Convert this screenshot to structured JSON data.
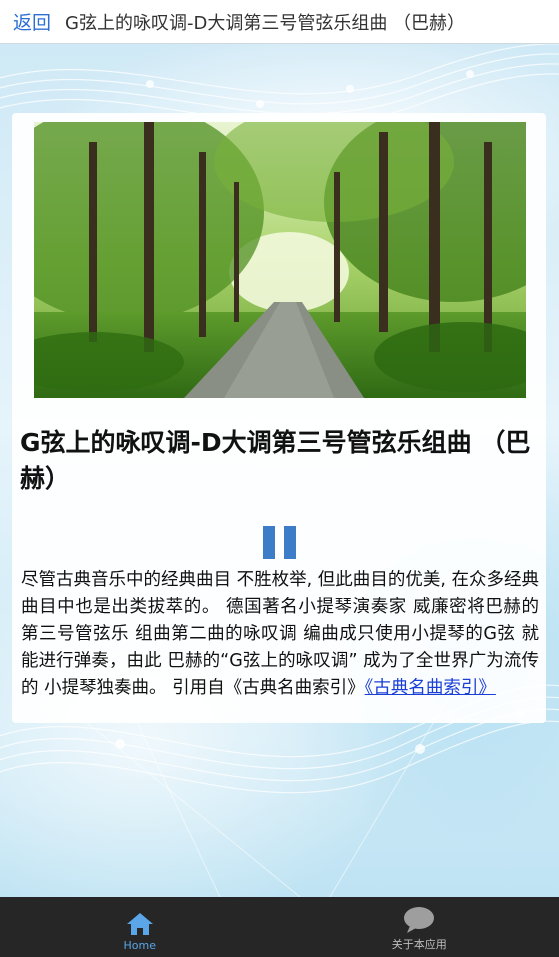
{
  "header": {
    "back_label": "返回",
    "title": "G弦上的咏叹调-D大调第三号管弦乐组曲 （巴赫）"
  },
  "song": {
    "title": "G弦上的咏叹调-D大调第三号管弦乐组曲 （巴赫）",
    "description": "尽管古典音乐中的经典曲目 不胜枚举, 但此曲目的优美, 在众多经典曲目中也是出类拔萃的。 德国著名小提琴演奏家 威廉密将巴赫的第三号管弦乐 组曲第二曲的咏叹调 编曲成只使用小提琴的G弦 就能进行弹奏，由此 巴赫的“G弦上的咏叹调” 成为了全世界广为流传的 小提琴独奏曲。 引用自《古典名曲索引》",
    "source_link": "《古典名曲索引》",
    "player_state": "playing"
  },
  "tabbar": {
    "tabs": [
      {
        "label": "Home",
        "icon": "home-icon",
        "active": true
      },
      {
        "label": "关于本应用",
        "icon": "chat-bubble-icon",
        "active": false
      }
    ]
  },
  "colors": {
    "accent": "#3d7dc8",
    "link": "#1a3fd6",
    "tabbar_bg": "#262626",
    "active_tab": "#5aa6e8"
  }
}
